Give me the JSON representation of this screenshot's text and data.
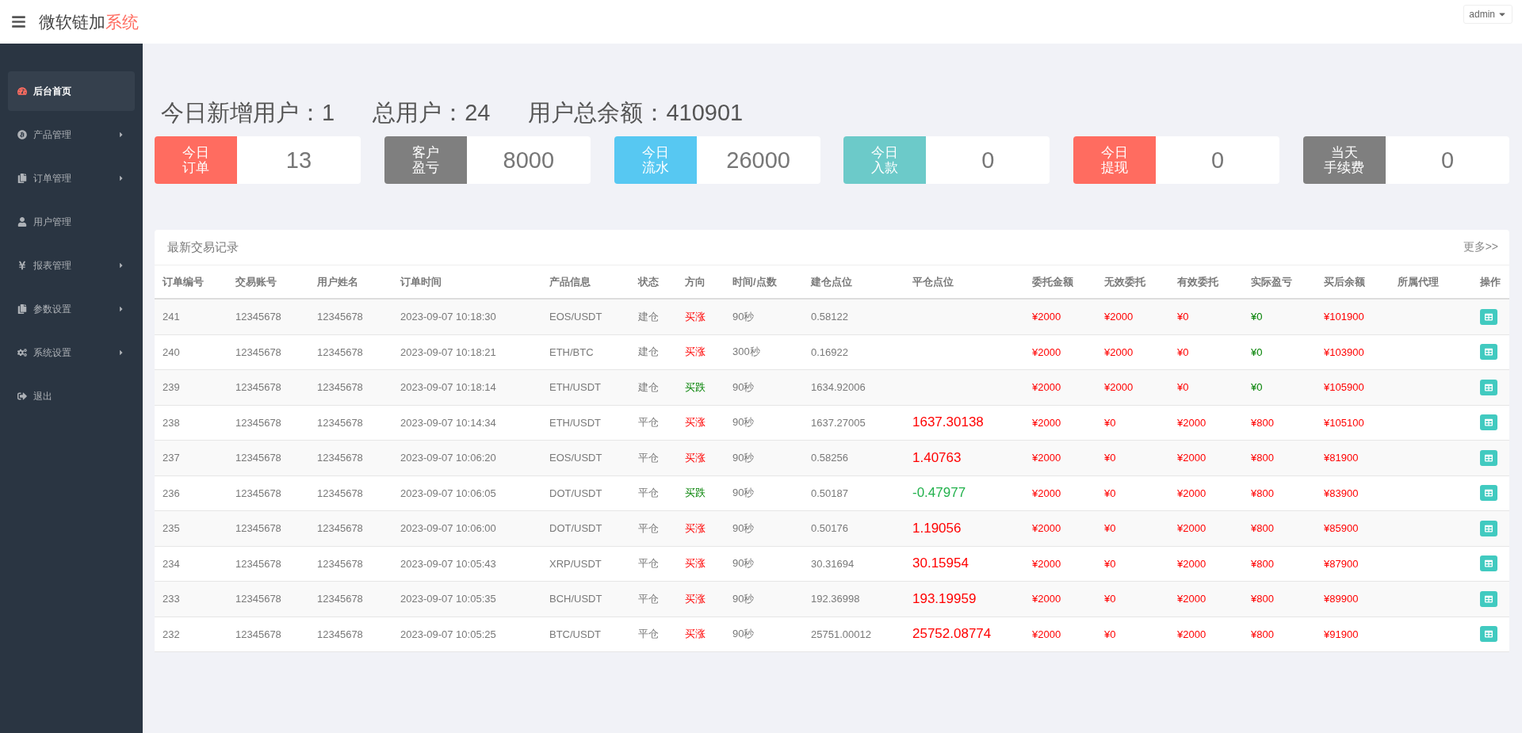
{
  "header": {
    "title": "微软链加",
    "title_accent": "系统",
    "user": "admin"
  },
  "sidebar": {
    "items": [
      {
        "label": "后台首页",
        "selected": true,
        "has_submenu": false
      },
      {
        "label": "产品管理",
        "selected": false,
        "has_submenu": true
      },
      {
        "label": "订单管理",
        "selected": false,
        "has_submenu": true
      },
      {
        "label": "用户管理",
        "selected": false,
        "has_submenu": false
      },
      {
        "label": "报表管理",
        "selected": false,
        "has_submenu": true
      },
      {
        "label": "参数设置",
        "selected": false,
        "has_submenu": true
      },
      {
        "label": "系统设置",
        "selected": false,
        "has_submenu": true
      },
      {
        "label": "退出",
        "selected": false,
        "has_submenu": false
      }
    ]
  },
  "summary": [
    {
      "label": "今日新增用户：",
      "value": "1"
    },
    {
      "label": "总用户：",
      "value": "24"
    },
    {
      "label": "用户总余额：",
      "value": "410901"
    }
  ],
  "cards": [
    {
      "label_lines": [
        "今日",
        "订单"
      ],
      "value": "13",
      "color": "#ff6c60"
    },
    {
      "label_lines": [
        "客户",
        "盈亏"
      ],
      "value": "8000",
      "color": "#7f7f7f"
    },
    {
      "label_lines": [
        "今日",
        "流水"
      ],
      "value": "26000",
      "color": "#57c8f2"
    },
    {
      "label_lines": [
        "今日",
        "入款"
      ],
      "value": "0",
      "color": "#6ccac9"
    },
    {
      "label_lines": [
        "今日",
        "提现"
      ],
      "value": "0",
      "color": "#ff6c60"
    },
    {
      "label_lines": [
        "当天",
        "手续费"
      ],
      "value": "0",
      "color": "#7f7f7f"
    }
  ],
  "table": {
    "title": "最新交易记录",
    "more": "更多>>",
    "columns": [
      "订单编号",
      "交易账号",
      "用户姓名",
      "订单时间",
      "产品信息",
      "状态",
      "方向",
      "时间/点数",
      "建仓点位",
      "平仓点位",
      "委托金额",
      "无效委托",
      "有效委托",
      "实际盈亏",
      "买后余额",
      "所属代理",
      "操作"
    ],
    "rows": [
      {
        "id": "241",
        "account": "12345678",
        "name": "12345678",
        "time": "2023-09-07 10:18:30",
        "product": "EOS/USDT",
        "status": "建仓",
        "direction": "买涨",
        "falling": false,
        "duration": "90秒",
        "open": "0.58122",
        "amount": "¥2000",
        "invalid": "¥2000",
        "valid": "¥0",
        "pnl": "¥0",
        "pnl_positive": false,
        "balance": "¥101900"
      },
      {
        "id": "240",
        "account": "12345678",
        "name": "12345678",
        "time": "2023-09-07 10:18:21",
        "product": "ETH/BTC",
        "status": "建仓",
        "direction": "买涨",
        "falling": false,
        "duration": "300秒",
        "open": "0.16922",
        "amount": "¥2000",
        "invalid": "¥2000",
        "valid": "¥0",
        "pnl": "¥0",
        "pnl_positive": false,
        "balance": "¥103900"
      },
      {
        "id": "239",
        "account": "12345678",
        "name": "12345678",
        "time": "2023-09-07 10:18:14",
        "product": "ETH/USDT",
        "status": "建仓",
        "direction": "买跌",
        "falling": true,
        "duration": "90秒",
        "open": "1634.92006",
        "amount": "¥2000",
        "invalid": "¥2000",
        "valid": "¥0",
        "pnl": "¥0",
        "pnl_positive": false,
        "balance": "¥105900"
      },
      {
        "id": "238",
        "account": "12345678",
        "name": "12345678",
        "time": "2023-09-07 10:14:34",
        "product": "ETH/USDT",
        "status": "平仓",
        "direction": "买涨",
        "falling": false,
        "duration": "90秒",
        "open": "1637.27005",
        "close": "1637.30138",
        "close_falling": false,
        "amount": "¥2000",
        "invalid": "¥0",
        "valid": "¥2000",
        "pnl": "¥800",
        "pnl_positive": true,
        "balance": "¥105100"
      },
      {
        "id": "237",
        "account": "12345678",
        "name": "12345678",
        "time": "2023-09-07 10:06:20",
        "product": "EOS/USDT",
        "status": "平仓",
        "direction": "买涨",
        "falling": false,
        "duration": "90秒",
        "open": "0.58256",
        "close": "1.40763",
        "close_falling": false,
        "amount": "¥2000",
        "invalid": "¥0",
        "valid": "¥2000",
        "pnl": "¥800",
        "pnl_positive": true,
        "balance": "¥81900"
      },
      {
        "id": "236",
        "account": "12345678",
        "name": "12345678",
        "time": "2023-09-07 10:06:05",
        "product": "DOT/USDT",
        "status": "平仓",
        "direction": "买跌",
        "falling": true,
        "duration": "90秒",
        "open": "0.50187",
        "close": "-0.47977",
        "close_falling": true,
        "amount": "¥2000",
        "invalid": "¥0",
        "valid": "¥2000",
        "pnl": "¥800",
        "pnl_positive": true,
        "balance": "¥83900"
      },
      {
        "id": "235",
        "account": "12345678",
        "name": "12345678",
        "time": "2023-09-07 10:06:00",
        "product": "DOT/USDT",
        "status": "平仓",
        "direction": "买涨",
        "falling": false,
        "duration": "90秒",
        "open": "0.50176",
        "close": "1.19056",
        "close_falling": false,
        "amount": "¥2000",
        "invalid": "¥0",
        "valid": "¥2000",
        "pnl": "¥800",
        "pnl_positive": true,
        "balance": "¥85900"
      },
      {
        "id": "234",
        "account": "12345678",
        "name": "12345678",
        "time": "2023-09-07 10:05:43",
        "product": "XRP/USDT",
        "status": "平仓",
        "direction": "买涨",
        "falling": false,
        "duration": "90秒",
        "open": "30.31694",
        "close": "30.15954",
        "close_falling": false,
        "amount": "¥2000",
        "invalid": "¥0",
        "valid": "¥2000",
        "pnl": "¥800",
        "pnl_positive": true,
        "balance": "¥87900"
      },
      {
        "id": "233",
        "account": "12345678",
        "name": "12345678",
        "time": "2023-09-07 10:05:35",
        "product": "BCH/USDT",
        "status": "平仓",
        "direction": "买涨",
        "falling": false,
        "duration": "90秒",
        "open": "192.36998",
        "close": "193.19959",
        "close_falling": false,
        "amount": "¥2000",
        "invalid": "¥0",
        "valid": "¥2000",
        "pnl": "¥800",
        "pnl_positive": true,
        "balance": "¥89900"
      },
      {
        "id": "232",
        "account": "12345678",
        "name": "12345678",
        "time": "2023-09-07 10:05:25",
        "product": "BTC/USDT",
        "status": "平仓",
        "direction": "买涨",
        "falling": false,
        "duration": "90秒",
        "open": "25751.00012",
        "close": "25752.08774",
        "close_falling": false,
        "amount": "¥2000",
        "invalid": "¥0",
        "valid": "¥2000",
        "pnl": "¥800",
        "pnl_positive": true,
        "balance": "¥91900"
      }
    ]
  }
}
